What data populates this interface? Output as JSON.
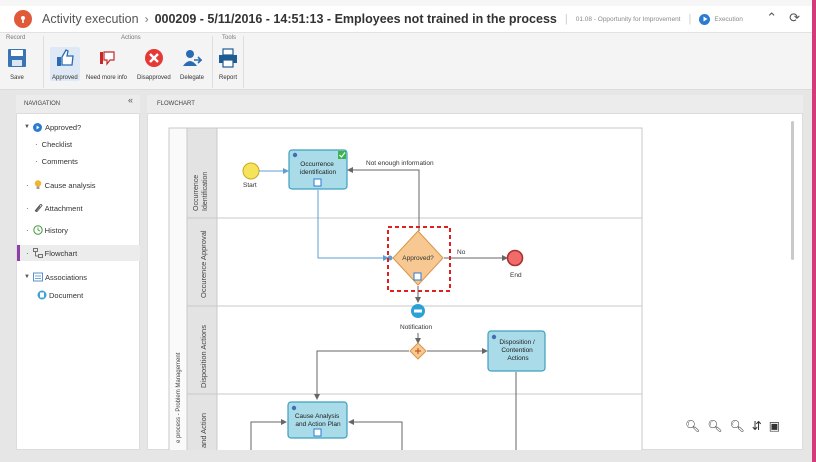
{
  "titlebar": {
    "crumb": "Activity execution",
    "separator": "›",
    "title": "000209 - 5/11/2016 - 14:51:13 - Employees not trained in the process",
    "type": "01.08 - Opportunity for Improvement",
    "status": "Execution"
  },
  "ribbon": {
    "groups": {
      "record": "Record",
      "actions": "Actions",
      "tools": "Tools"
    },
    "save": "Save",
    "approved": "Approved",
    "need_more_info": "Need more info",
    "disapproved": "Disapproved",
    "delegate": "Delegate",
    "report": "Report"
  },
  "navigation": {
    "header": "NAVIGATION",
    "collapse": "«",
    "items": [
      {
        "label": "Approved?"
      },
      {
        "label": "Checklist"
      },
      {
        "label": "Comments"
      },
      {
        "label": "Cause analysis"
      },
      {
        "label": "Attachment"
      },
      {
        "label": "History"
      },
      {
        "label": "Flowchart"
      },
      {
        "label": "Associations"
      },
      {
        "label": "Document"
      }
    ]
  },
  "flowchart": {
    "header": "FLOWCHART",
    "pool": "e process - Problem Management",
    "lanes": [
      "Occurrence Identification",
      "Occurence Approval",
      "Disposition Actions",
      "and Action"
    ],
    "nodes": {
      "start": "Start",
      "occurrence": [
        "Occurrence",
        "identification"
      ],
      "approved": "Approved?",
      "end": "End",
      "notification": "Notification",
      "disposition": [
        "Disposition /",
        "Contention",
        "Actions"
      ],
      "cause": [
        "Cause Analysis",
        "and Action Plan"
      ]
    },
    "edges": {
      "not_enough": "Not enough information",
      "no": "No"
    }
  },
  "colors": {
    "accent": "#d6397a",
    "task_fill": "#a9dbe8",
    "task_stroke": "#3e9fbf",
    "gateway_fill": "#f7c891",
    "selection": "#e02020",
    "end_fill": "#f26b6b",
    "start_fill": "#f6e35a"
  }
}
